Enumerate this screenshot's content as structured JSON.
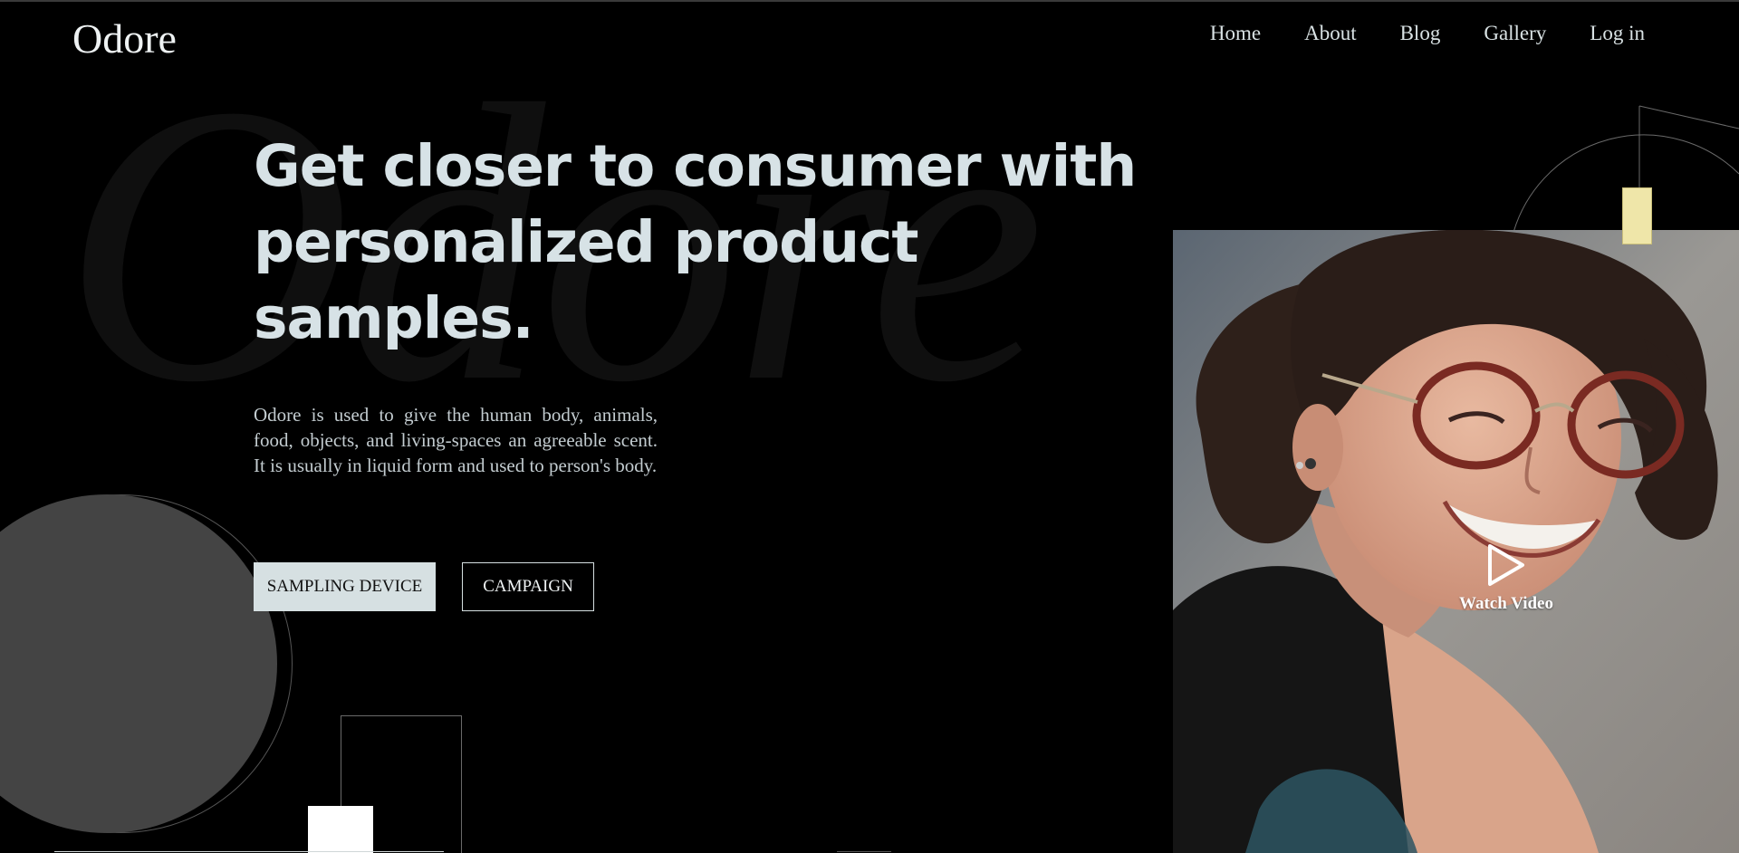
{
  "brand": {
    "logo_text": "Odore",
    "watermark_text": "Odore"
  },
  "nav": {
    "items": [
      {
        "label": "Home"
      },
      {
        "label": "About"
      },
      {
        "label": "Blog"
      },
      {
        "label": "Gallery"
      },
      {
        "label": "Log in"
      }
    ]
  },
  "hero": {
    "title": "Get closer to consumer with personalized product samples.",
    "description": "Odore is used to give the human body, animals, food, objects, and living-spaces an agreeable scent. It is usually in liquid form and used to person's body.",
    "primary_button_label": "SAMPLING DEVICE",
    "secondary_button_label": "CAMPAIGN"
  },
  "media": {
    "watch_video_label": "Watch Video",
    "play_icon": "play-icon"
  },
  "colors": {
    "background": "#000000",
    "headline": "#d7e2e6",
    "button_fill": "#d6e0e2",
    "accent_tab": "#efe6a9",
    "circle_fill": "#444444"
  }
}
